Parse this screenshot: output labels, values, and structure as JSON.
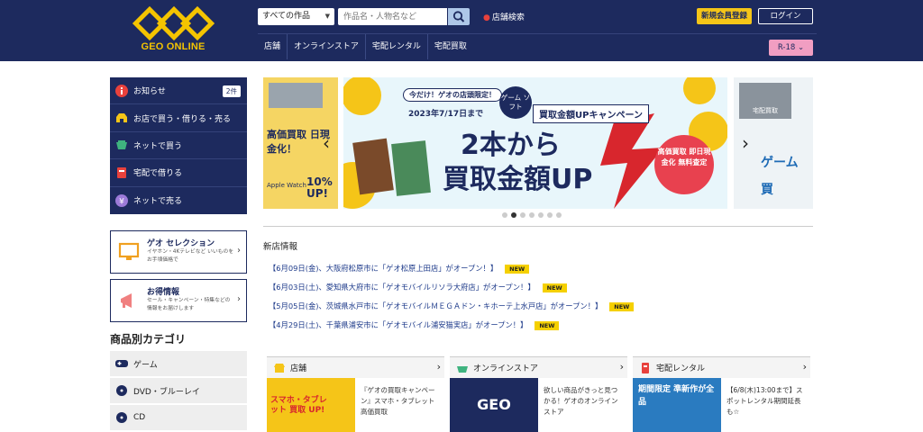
{
  "header": {
    "logo_text": "GEO ONLINE",
    "category_select": "すべての作品",
    "search_placeholder": "作品名・人物名など",
    "store_search": "店舗検索",
    "register": "新規会員登録",
    "login": "ログイン",
    "nav": [
      "店舗",
      "オンラインストア",
      "宅配レンタル",
      "宅配買取"
    ],
    "r18": "R-18"
  },
  "sidebar": {
    "items": [
      {
        "label": "お知らせ",
        "icon": "info-icon",
        "badge": "2件"
      },
      {
        "label": "お店で買う・借りる・売る",
        "icon": "shop-icon"
      },
      {
        "label": "ネットで買う",
        "icon": "cart-icon"
      },
      {
        "label": "宅配で借りる",
        "icon": "delivery-icon"
      },
      {
        "label": "ネットで売る",
        "icon": "sell-icon"
      }
    ],
    "promos": [
      {
        "title": "ゲオ セレクション",
        "desc": "イヤホン・4Kテレビなど いいものをお手頃価格で",
        "icon": "monitor-icon"
      },
      {
        "title": "お得情報",
        "desc": "セール・キャンペーン・特集などの 情報をお届けします",
        "icon": "megaphone-icon"
      }
    ],
    "category_heading": "商品別カテゴリ",
    "categories": [
      {
        "label": "ゲーム",
        "icon": "gamepad-icon"
      },
      {
        "label": "DVD・ブルーレイ",
        "icon": "disc-icon"
      },
      {
        "label": "CD",
        "icon": "cd-icon"
      }
    ]
  },
  "banner": {
    "tag": "今だけ！ゲオの店頭限定！",
    "date": "2023年7/17日まで",
    "game_soft": "ゲーム ソフト",
    "campaign": "買取金額UPキャンペーン",
    "main_line1": "2本から",
    "main_line2": "買取金額UP",
    "stamp": "高価買取 即日現金化 無料査定",
    "left_text": "高価買取 日現金化！",
    "left_small": "Apple Watch",
    "left_pct": "10% UP!",
    "right_label": "宅配買取",
    "right_text": "ゲーム 買",
    "slides": 7,
    "active_slide": 1
  },
  "news": {
    "heading": "新店情報",
    "badge": "NEW",
    "items": [
      "【6月09日(金)、大阪府松原市に「ゲオ松原上田店」がオープン！】",
      "【6月03日(土)、愛知県大府市に「ゲオモバイルリソラ大府店」がオープン！】",
      "【5月05日(金)、茨城県水戸市に「ゲオモバイルＭＥＧＡドン・キホーテ上水戸店」がオープン！】",
      "【4月29日(土)、千葉県浦安市に「ゲオモバイル浦安猫実店」がオープン！】"
    ]
  },
  "cards": [
    {
      "title": "店舗",
      "icon": "store-icon",
      "text": "『ゲオの買取キャンペーン』スマホ・タブレット高価買取",
      "thumb_text": "スマホ・タブレット 買取 UP!"
    },
    {
      "title": "オンラインストア",
      "icon": "basket-icon",
      "text": "欲しい商品がきっと見つかる！ゲオのオンラインストア",
      "thumb_text": "GEO"
    },
    {
      "title": "宅配レンタル",
      "icon": "rental-icon",
      "text": "【6/8(木)13:00まで】スポットレンタル期間延長も☆",
      "thumb_text": "期間限定 準新作が全品"
    }
  ]
}
